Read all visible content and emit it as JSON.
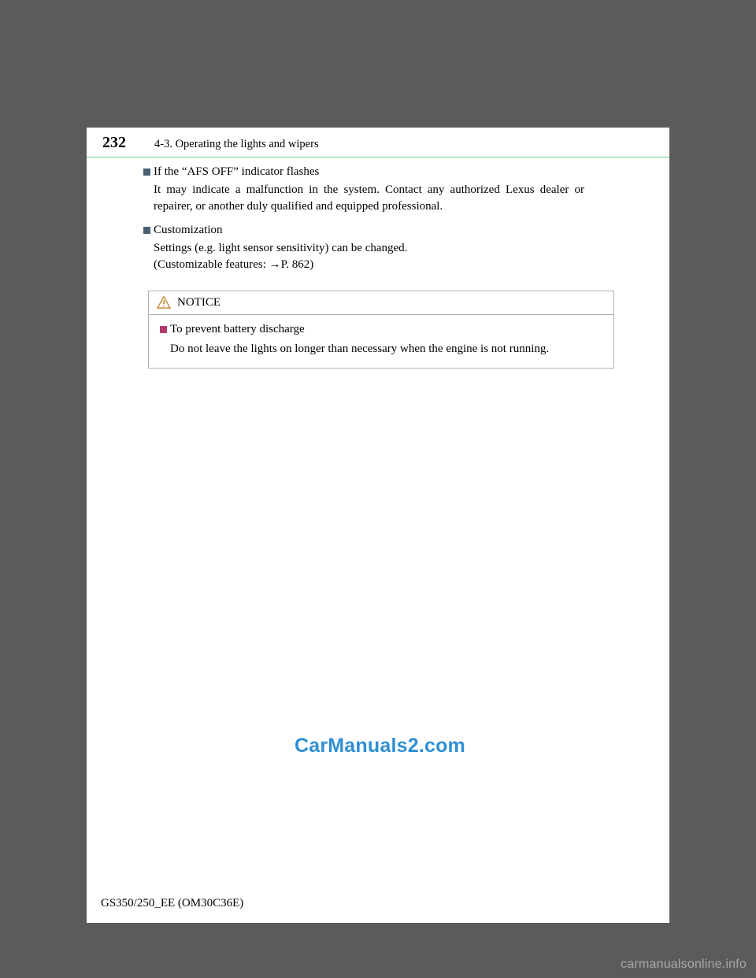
{
  "header": {
    "page_number": "232",
    "section": "4-3. Operating the lights and wipers"
  },
  "items": [
    {
      "heading": "If the “AFS OFF” indicator flashes",
      "body": "It may indicate a malfunction in the system. Contact any authorized Lexus dealer or repairer, or another duly qualified and equipped professional."
    },
    {
      "heading": "Customization",
      "body_line1": "Settings (e.g. light sensor sensitivity) can be changed.",
      "body_line2_pre": "(Customizable features: ",
      "body_line2_arrow": "→",
      "body_line2_post": "P. 862)"
    }
  ],
  "notice": {
    "label": "NOTICE",
    "item_heading": "To prevent battery discharge",
    "item_body": "Do not leave the lights on longer than necessary when the engine is not run­ning."
  },
  "watermark_center": "CarManuals2.com",
  "doc_code": "GS350/250_EE (OM30C36E)",
  "watermark_footer": "carmanualsonline.info"
}
